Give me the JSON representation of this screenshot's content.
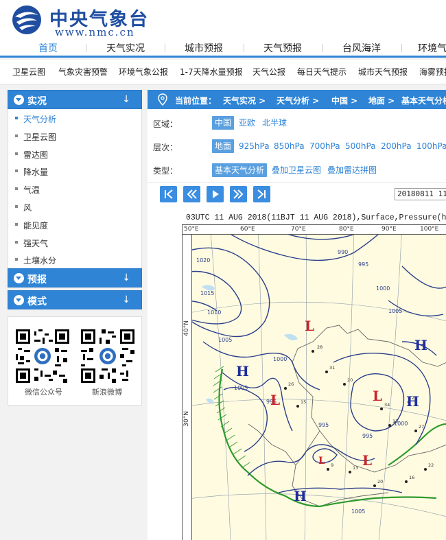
{
  "header": {
    "logo_cn": "中央气象台",
    "logo_url": "www.nmc.cn"
  },
  "main_nav": [
    "首页",
    "天气实况",
    "城市预报",
    "天气预报",
    "台风海洋",
    "环境气"
  ],
  "sub_nav": [
    "卫星云图",
    "气象灾害预警",
    "环境气象公报",
    "1-7天降水量预报",
    "天气公报",
    "每日天气提示",
    "城市天气预报",
    "海雾预报"
  ],
  "sidebar": {
    "sections": [
      {
        "title": "实况",
        "arrow": "↓"
      },
      {
        "title": "预报",
        "arrow": "↓"
      },
      {
        "title": "模式",
        "arrow": "↓"
      }
    ],
    "items": [
      "天气分析",
      "卫星云图",
      "雷达图",
      "降水量",
      "气温",
      "风",
      "能见度",
      "强天气",
      "土壤水分"
    ],
    "qr": [
      {
        "caption": "微信公众号"
      },
      {
        "caption": "新浪微博"
      }
    ]
  },
  "breadcrumb": {
    "label": "当前位置：",
    "items": [
      "天气实况 >",
      "天气分析 >",
      "中国 >",
      "地面 >",
      "基本天气分析"
    ]
  },
  "filters": {
    "region": {
      "label": "区域：",
      "options": [
        "中国",
        "亚欧",
        "北半球"
      ],
      "selected": 0
    },
    "level": {
      "label": "层次：",
      "options": [
        "地面",
        "925hPa",
        "850hPa",
        "700hPa",
        "500hPa",
        "200hPa",
        "100hPa"
      ],
      "selected": 0
    },
    "type": {
      "label": "类型：",
      "options": [
        "基本天气分析",
        "叠加卫星云图",
        "叠加雷达拼图"
      ],
      "selected": 0
    }
  },
  "player": {
    "time_value": "20180811 11:"
  },
  "map": {
    "title": "03UTC 11  AUG 2018(11BJT 11  AUG 2018),Surface,Pressure(h",
    "lon_labels": [
      "50°E",
      "60°E",
      "70°E",
      "80°E",
      "90°E",
      "100°E"
    ],
    "lat_labels": [
      "40°N",
      "30°N"
    ],
    "highs": [
      "H",
      "H",
      "H",
      "H"
    ],
    "lows": [
      "L",
      "L",
      "L",
      "L",
      "L"
    ],
    "isobar_labels": [
      "1020",
      "1015",
      "1010",
      "1005",
      "1005",
      "1000",
      "995",
      "995",
      "990",
      "995",
      "1000",
      "1005",
      "995",
      "1000",
      "1005"
    ]
  }
}
